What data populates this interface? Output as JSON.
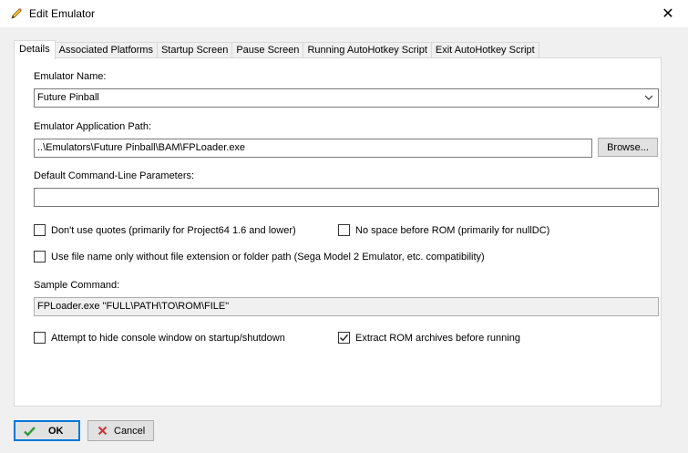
{
  "window": {
    "title": "Edit Emulator",
    "close_glyph": "✕",
    "app_icon": "pencil-icon"
  },
  "tabs": [
    {
      "label": "Details",
      "active": true
    },
    {
      "label": "Associated Platforms"
    },
    {
      "label": "Startup Screen"
    },
    {
      "label": "Pause Screen"
    },
    {
      "label": "Running AutoHotkey Script"
    },
    {
      "label": "Exit AutoHotkey Script"
    }
  ],
  "details": {
    "name_label": "Emulator Name:",
    "name_value": "Future Pinball",
    "path_label": "Emulator Application Path:",
    "path_value": "..\\Emulators\\Future Pinball\\BAM\\FPLoader.exe",
    "browse_label": "Browse...",
    "params_label": "Default Command-Line Parameters:",
    "params_value": "",
    "opt_no_quotes": "Don't use quotes (primarily for Project64 1.6 and lower)",
    "opt_no_space": "No space before ROM (primarily for nullDC)",
    "opt_filename_only": "Use file name only without file extension or folder path (Sega Model 2 Emulator, etc. compatibility)",
    "sample_label": "Sample Command:",
    "sample_value": "FPLoader.exe \"FULL\\PATH\\TO\\ROM\\FILE\"",
    "opt_hide_console": "Attempt to hide console window on startup/shutdown",
    "opt_extract": "Extract ROM archives before running",
    "checks": {
      "no_quotes": false,
      "no_space": false,
      "filename_only": false,
      "hide_console": false,
      "extract": true
    }
  },
  "footer": {
    "ok_label": "OK",
    "cancel_label": "Cancel"
  },
  "colors": {
    "accent": "#0078d7",
    "ok_check": "#2e9e3a",
    "cancel_x": "#d13438"
  }
}
